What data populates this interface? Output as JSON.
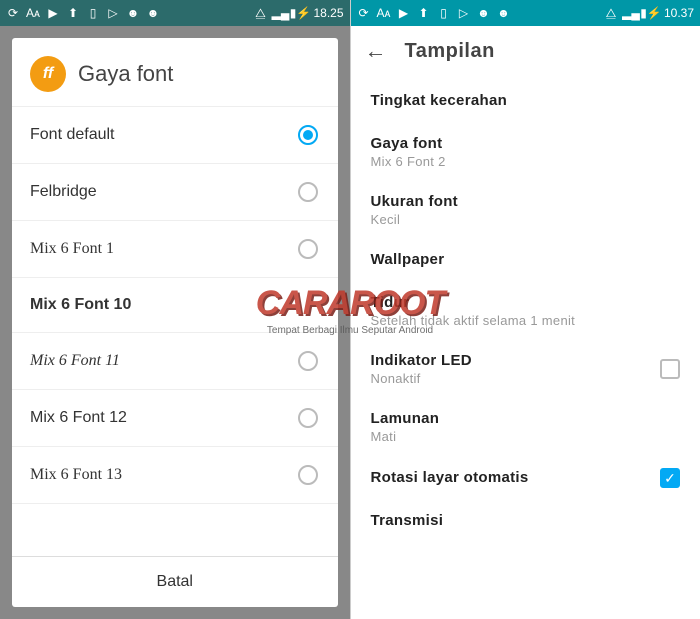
{
  "left": {
    "statusbar": {
      "time": "18.25",
      "icons": [
        "sync",
        "font",
        "play",
        "upload",
        "doc",
        "play2",
        "droid",
        "droid2",
        "wifi",
        "signal",
        "battery"
      ]
    },
    "dialog": {
      "icon_label": "ff",
      "title": "Gaya font",
      "options": [
        {
          "label": "Font default",
          "selected": true,
          "style": ""
        },
        {
          "label": "Felbridge",
          "selected": false,
          "style": ""
        },
        {
          "label": "Mix 6 Font 1",
          "selected": false,
          "style": "serif"
        },
        {
          "label": "Mix 6 Font 10",
          "selected": false,
          "style": "bold",
          "no_radio": true
        },
        {
          "label": "Mix 6 Font 11",
          "selected": false,
          "style": "script"
        },
        {
          "label": "Mix 6 Font 12",
          "selected": false,
          "style": ""
        },
        {
          "label": "Mix 6 Font 13",
          "selected": false,
          "style": "serif"
        }
      ],
      "cancel": "Batal"
    }
  },
  "right": {
    "statusbar": {
      "time": "10.37",
      "icons": [
        "sync",
        "font",
        "play",
        "upload",
        "doc",
        "play2",
        "droid",
        "droid2",
        "wifi",
        "signal",
        "battery"
      ]
    },
    "appbar": {
      "title": "Tampilan"
    },
    "settings": [
      {
        "title": "Tingkat kecerahan",
        "sub": ""
      },
      {
        "title": "Gaya font",
        "sub": "Mix 6 Font 2"
      },
      {
        "title": "Ukuran font",
        "sub": "Kecil"
      },
      {
        "title": "Wallpaper",
        "sub": ""
      },
      {
        "title": "Tidur",
        "sub": "Setelah tidak aktif selama 1 menit"
      },
      {
        "title": "Indikator LED",
        "sub": "Nonaktif",
        "checkbox": true,
        "checked": false
      },
      {
        "title": "Lamunan",
        "sub": "Mati"
      },
      {
        "title": "Rotasi layar otomatis",
        "sub": "",
        "checkbox": true,
        "checked": true
      },
      {
        "title": "Transmisi",
        "sub": ""
      }
    ]
  },
  "watermark": {
    "main": "CARAROOT",
    "sub": "Tempat Berbagi Ilmu Seputar Android"
  }
}
